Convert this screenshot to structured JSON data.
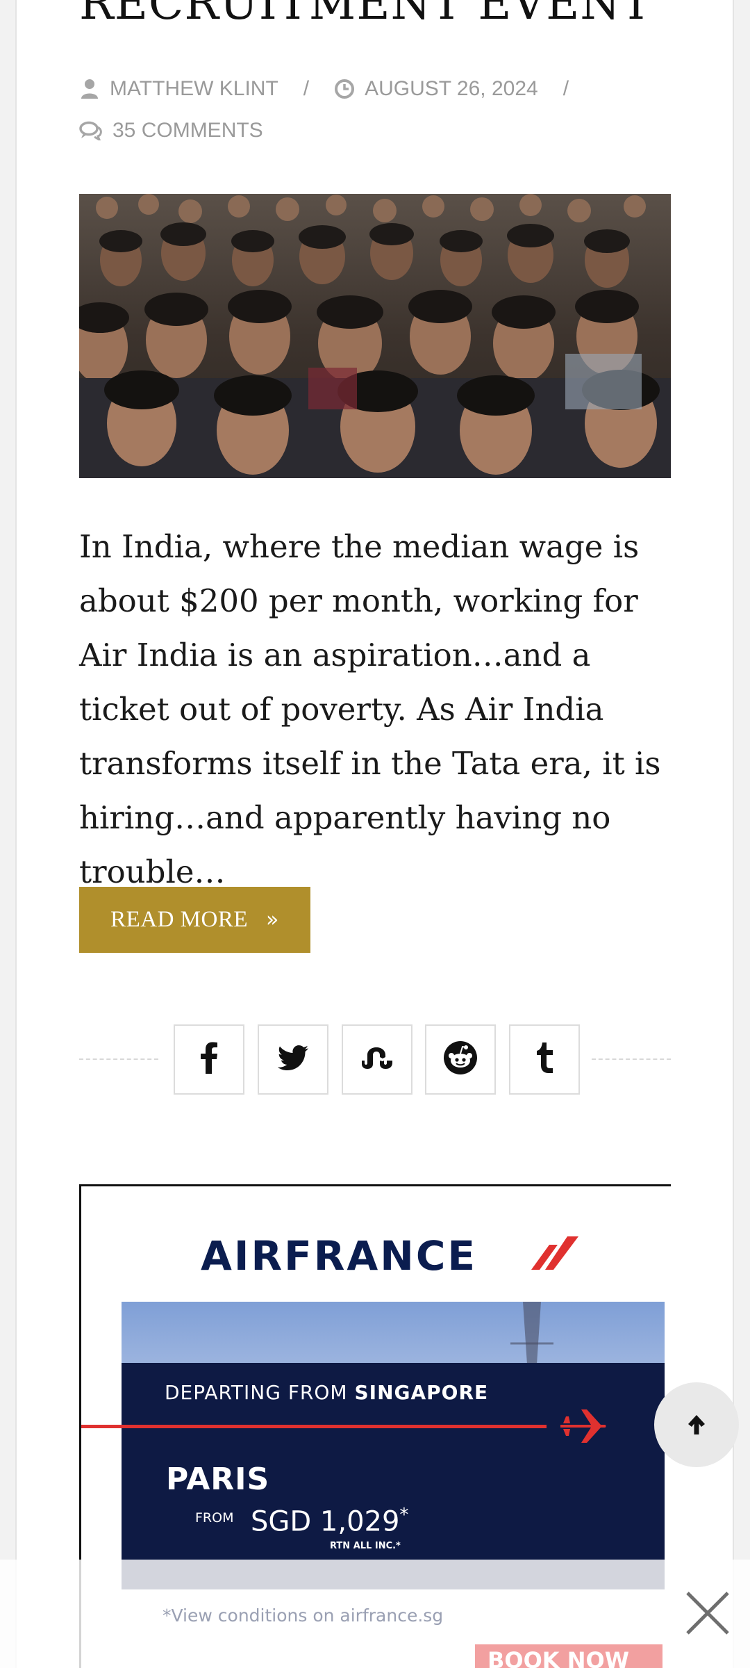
{
  "post": {
    "title": "RECRUITMENT EVENT",
    "author": "MATTHEW KLINT",
    "date": "AUGUST 26, 2024",
    "comments": "35 COMMENTS",
    "separator": "/",
    "excerpt": "In India, where the median wage is about $200 per month, working for Air India is an aspiration…and a ticket out of poverty. As Air India transforms itself in the Tata era, it is hiring…and apparently having no trouble…",
    "read_more_label": "READ MORE"
  },
  "share": {
    "icons": [
      "facebook-icon",
      "twitter-icon",
      "stumbleupon-icon",
      "reddit-icon",
      "tumblr-icon"
    ]
  },
  "ad": {
    "brand": "AIRFRANCE",
    "departing_prefix": "DEPARTING FROM ",
    "departing_city": "SINGAPORE",
    "destination": "PARIS",
    "from_label": "FROM",
    "price": "SGD 1,029",
    "price_mark": "*",
    "price_note": "RTN ALL INC.*",
    "conditions": "*View conditions on airfrance.sg",
    "cta": "BOOK NOW"
  },
  "colors": {
    "accent": "#b08f2c",
    "ad_navy": "#0e1a44",
    "ad_red": "#e0312f",
    "meta_gray": "#9a9a9a"
  }
}
